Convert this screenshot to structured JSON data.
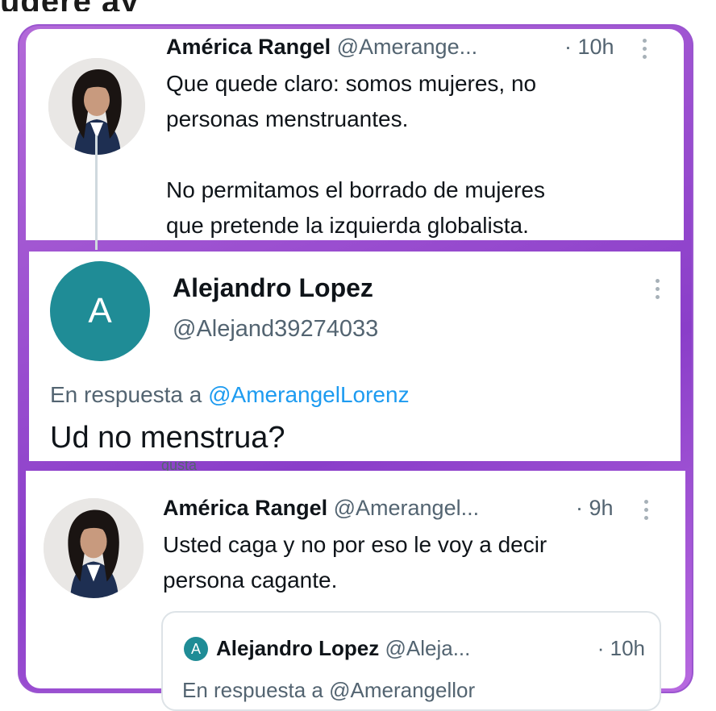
{
  "top_fragment": "ugere ay",
  "tweet1": {
    "name": "América Rangel",
    "handle": "@Amerange...",
    "time": "· 10h",
    "text": "Que quede claro: somos mujeres, no\npersonas menstruantes.\n\nNo permitamos el borrado de mujeres\nque pretende la izquierda globalista."
  },
  "tweet2": {
    "avatar_letter": "A",
    "name": "Alejandro Lopez",
    "handle": "@Alejand39274033",
    "reply_prefix": "En respuesta a ",
    "reply_mention": "@AmerangelLorenz",
    "text": "Ud no menstrua?"
  },
  "under_fragment": "gusta",
  "tweet3": {
    "name": "América Rangel",
    "handle": "@Amerangel...",
    "time": "· 9h",
    "text": "Usted caga y no por eso le voy a decir\npersona cagante.",
    "quote": {
      "avatar_letter": "A",
      "name": "Alejandro Lopez",
      "handle": "@Aleja...",
      "time": "· 10h",
      "cut_text": "En respuesta a @Amerangellor"
    }
  },
  "colors": {
    "frame_purple": "#9b4fd0",
    "avatar_teal": "#1f8c96",
    "mention_blue": "#1d9bf0",
    "secondary_text": "#536471"
  }
}
